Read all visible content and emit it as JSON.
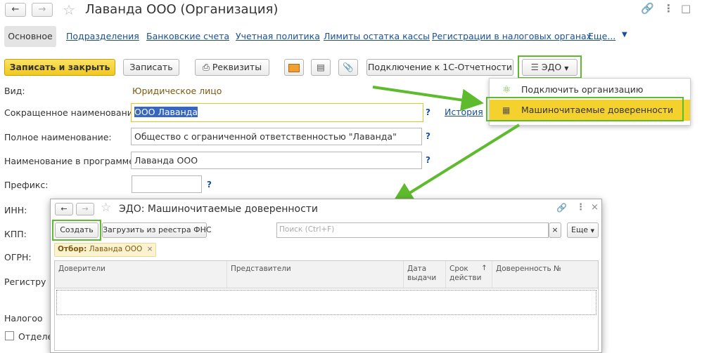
{
  "window": {
    "title": "Лаванда ООО (Организация)"
  },
  "tabs": {
    "active": "Основное",
    "links": [
      "Подразделения",
      "Банковские счета",
      "Учетная политика",
      "Лимиты остатка кассы",
      "Регистрации в налоговых органах",
      "Еще..."
    ]
  },
  "toolbar": {
    "save_close": "Записать и закрыть",
    "save": "Записать",
    "requisites": "Реквизиты",
    "connect_1c": "Подключение к 1С-Отчетности",
    "edo": "ЭДО"
  },
  "edo_menu": {
    "items": [
      "Подключить организацию",
      "Машиночитаемые доверенности"
    ]
  },
  "form": {
    "vid_label": "Вид:",
    "vid_value": "Юридическое лицо",
    "short_label": "Сокращенное наименование:",
    "short_value": "ООО Лаванда",
    "history": "История",
    "full_label": "Полное наименование:",
    "full_value": "Общество с ограниченной ответственностью \"Лаванда\"",
    "prog_label": "Наименование в программе:",
    "prog_value": "Лаванда ООО",
    "prefix_label": "Префикс:",
    "prefix_value": "",
    "inn_label": "ИНН:",
    "kpp_label": "КПП:",
    "ogrn_label": "ОГРН:",
    "reg_label": "Регистру",
    "nalog_label": "Налогоо",
    "otdel_label": "Отделе",
    "help": "?"
  },
  "popup": {
    "title": "ЭДО: Машиночитаемые доверенности",
    "create": "Создать",
    "load": "Загрузить из реестра ФНС",
    "search_placeholder": "Поиск (Ctrl+F)",
    "more": "Еще",
    "filter_label": "Отбор:",
    "filter_value": "Лаванда ООО",
    "columns": [
      "Доверители",
      "Представители",
      "Дата выдачи",
      "Срок действи",
      "Доверенность №"
    ]
  },
  "colors": {
    "accent_yellow": "#f5d12e",
    "highlight_green": "#5fbb2e",
    "link_blue": "#1a4f9e"
  }
}
